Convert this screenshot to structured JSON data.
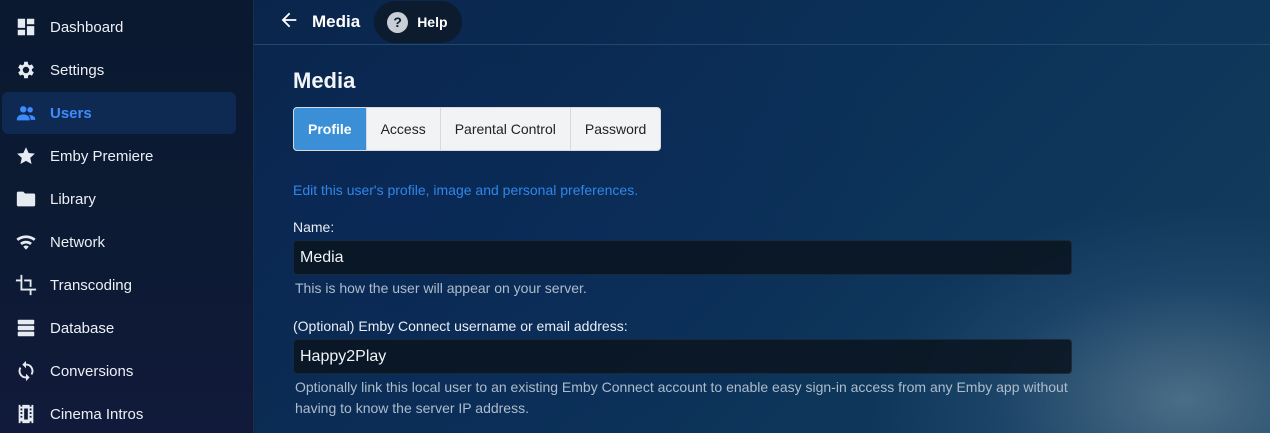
{
  "sidebar": {
    "items": [
      {
        "label": "Dashboard",
        "icon": "dashboard-icon",
        "active": false
      },
      {
        "label": "Settings",
        "icon": "gear-icon",
        "active": false
      },
      {
        "label": "Users",
        "icon": "users-icon",
        "active": true
      },
      {
        "label": "Emby Premiere",
        "icon": "star-icon",
        "active": false
      },
      {
        "label": "Library",
        "icon": "folder-icon",
        "active": false
      },
      {
        "label": "Network",
        "icon": "wifi-icon",
        "active": false
      },
      {
        "label": "Transcoding",
        "icon": "crop-icon",
        "active": false
      },
      {
        "label": "Database",
        "icon": "database-icon",
        "active": false
      },
      {
        "label": "Conversions",
        "icon": "sync-icon",
        "active": false
      },
      {
        "label": "Cinema Intros",
        "icon": "film-icon",
        "active": false
      }
    ]
  },
  "header": {
    "title": "Media",
    "help_label": "Help"
  },
  "main": {
    "page_title": "Media",
    "tabs": [
      {
        "label": "Profile",
        "active": true
      },
      {
        "label": "Access",
        "active": false
      },
      {
        "label": "Parental Control",
        "active": false
      },
      {
        "label": "Password",
        "active": false
      }
    ],
    "description": "Edit this user's profile, image and personal preferences.",
    "name_label": "Name:",
    "name_value": "Media",
    "name_help": "This is how the user will appear on your server.",
    "connect_label": "(Optional) Emby Connect username or email address:",
    "connect_value": "Happy2Play",
    "connect_help": "Optionally link this local user to an existing Emby Connect account to enable easy sign-in access from any Emby app without having to know the server IP address."
  },
  "colors": {
    "accent": "#3d8bff",
    "tab_active": "#3a8fd6",
    "link": "#2f86e8"
  }
}
